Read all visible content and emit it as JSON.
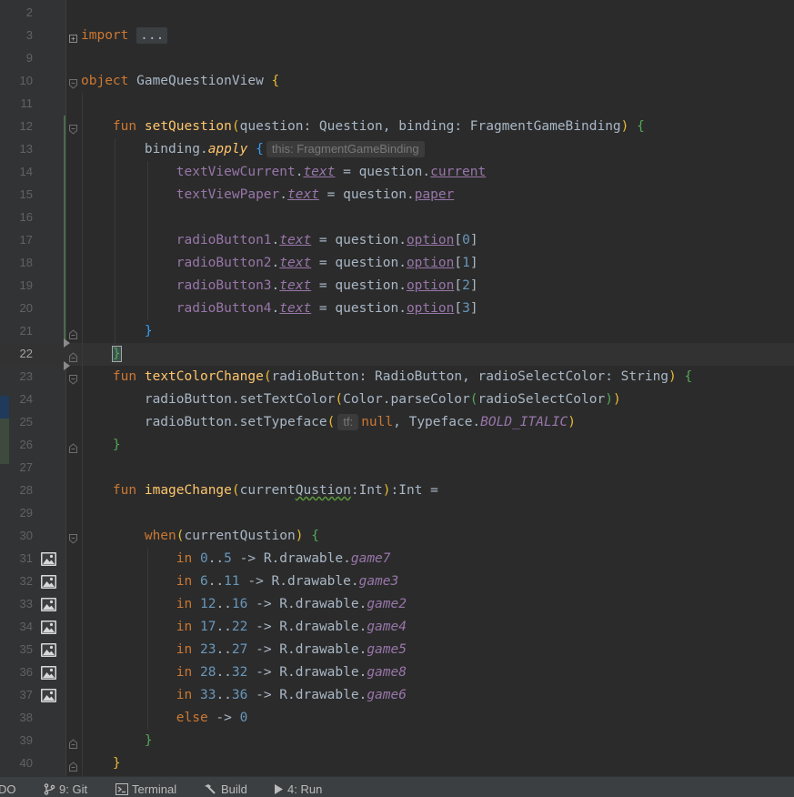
{
  "editor": {
    "current_line": "22",
    "lines": [
      {
        "n": "2",
        "fold": "",
        "icon": false,
        "html": ""
      },
      {
        "n": "3",
        "fold": "plus",
        "icon": false,
        "html": "<span class='kw'>import</span> <span class='collapsed'>...</span>"
      },
      {
        "n": "9",
        "fold": "",
        "icon": false,
        "html": ""
      },
      {
        "n": "10",
        "fold": "open",
        "icon": false,
        "html": "<span class='kw'>object</span> GameQuestionView <span class='paren-y'>{</span>"
      },
      {
        "n": "11",
        "fold": "",
        "icon": false,
        "html": ""
      },
      {
        "n": "12",
        "fold": "open",
        "icon": false,
        "html": "    <span class='kw'>fun</span> <span class='fn'>setQuestion</span><span class='paren-y'>(</span>question: Question, binding: FragmentGameBinding<span class='paren-y'>)</span> <span class='paren-g'>{</span>"
      },
      {
        "n": "13",
        "fold": "",
        "icon": false,
        "html": "        binding.<span class='ext-fn'>apply</span> <span class='paren-b'>{</span><span class='hint'>this: FragmentGameBinding</span>"
      },
      {
        "n": "14",
        "fold": "",
        "icon": false,
        "html": "            <span class='prop'>textViewCurrent</span>.<span class='uitalprop'>text</span> = question.<span class='uprop'>current</span>"
      },
      {
        "n": "15",
        "fold": "",
        "icon": false,
        "html": "            <span class='prop'>textViewPaper</span>.<span class='uitalprop'>text</span> = question.<span class='uprop'>paper</span>"
      },
      {
        "n": "16",
        "fold": "",
        "icon": false,
        "html": ""
      },
      {
        "n": "17",
        "fold": "",
        "icon": false,
        "html": "            <span class='prop'>radioButton1</span>.<span class='uitalprop'>text</span> = question.<span class='uprop'>option</span>[<span class='num'>0</span>]"
      },
      {
        "n": "18",
        "fold": "",
        "icon": false,
        "html": "            <span class='prop'>radioButton2</span>.<span class='uitalprop'>text</span> = question.<span class='uprop'>option</span>[<span class='num'>1</span>]"
      },
      {
        "n": "19",
        "fold": "",
        "icon": false,
        "html": "            <span class='prop'>radioButton3</span>.<span class='uitalprop'>text</span> = question.<span class='uprop'>option</span>[<span class='num'>2</span>]"
      },
      {
        "n": "20",
        "fold": "",
        "icon": false,
        "html": "            <span class='prop'>radioButton4</span>.<span class='uitalprop'>text</span> = question.<span class='uprop'>option</span>[<span class='num'>3</span>]"
      },
      {
        "n": "21",
        "fold": "close",
        "icon": false,
        "html": "        <span class='paren-b'>}</span>"
      },
      {
        "n": "22",
        "fold": "close",
        "icon": false,
        "html": "    <span class='paren-g brace-match'>}</span>"
      },
      {
        "n": "23",
        "fold": "open",
        "icon": false,
        "html": "    <span class='kw'>fun</span> <span class='fn'>textColorChange</span><span class='paren-y'>(</span>radioButton: RadioButton, radioSelectColor: String<span class='paren-y'>)</span> <span class='paren-g'>{</span>"
      },
      {
        "n": "24",
        "fold": "",
        "icon": false,
        "html": "        radioButton.setTextColor<span class='paren-y'>(</span>Color.parseColor<span class='paren-g'>(</span>radioSelectColor<span class='paren-g'>)</span><span class='paren-y'>)</span>"
      },
      {
        "n": "25",
        "fold": "",
        "icon": false,
        "html": "        radioButton.setTypeface<span class='paren-y'>(</span><span class='hint'>tf:</span><span class='kw'>null</span>, Typeface.<span class='ital'>BOLD_ITALIC</span><span class='paren-y'>)</span>"
      },
      {
        "n": "26",
        "fold": "close",
        "icon": false,
        "html": "    <span class='paren-g'>}</span>"
      },
      {
        "n": "27",
        "fold": "",
        "icon": false,
        "html": ""
      },
      {
        "n": "28",
        "fold": "",
        "icon": false,
        "html": "    <span class='kw'>fun</span> <span class='fn'>imageChange</span><span class='paren-y'>(</span>current<span class='typo'>Qustion</span>:Int<span class='paren-y'>)</span>:Int ="
      },
      {
        "n": "29",
        "fold": "",
        "icon": false,
        "html": ""
      },
      {
        "n": "30",
        "fold": "open",
        "icon": false,
        "html": "        <span class='kw'>when</span><span class='paren-y'>(</span>currentQustion<span class='paren-y'>)</span> <span class='paren-g'>{</span>"
      },
      {
        "n": "31",
        "fold": "",
        "icon": true,
        "html": "            <span class='kw'>in</span> <span class='num'>0</span>..<span class='num'>5</span> -&gt; R.drawable.<span class='ital'>game7</span>"
      },
      {
        "n": "32",
        "fold": "",
        "icon": true,
        "html": "            <span class='kw'>in</span> <span class='num'>6</span>..<span class='num'>11</span> -&gt; R.drawable.<span class='ital'>game3</span>"
      },
      {
        "n": "33",
        "fold": "",
        "icon": true,
        "html": "            <span class='kw'>in</span> <span class='num'>12</span>..<span class='num'>16</span> -&gt; R.drawable.<span class='ital'>game2</span>"
      },
      {
        "n": "34",
        "fold": "",
        "icon": true,
        "html": "            <span class='kw'>in</span> <span class='num'>17</span>..<span class='num'>22</span> -&gt; R.drawable.<span class='ital'>game4</span>"
      },
      {
        "n": "35",
        "fold": "",
        "icon": true,
        "html": "            <span class='kw'>in</span> <span class='num'>23</span>..<span class='num'>27</span> -&gt; R.drawable.<span class='ital'>game5</span>"
      },
      {
        "n": "36",
        "fold": "",
        "icon": true,
        "html": "            <span class='kw'>in</span> <span class='num'>28</span>..<span class='num'>32</span> -&gt; R.drawable.<span class='ital'>game8</span>"
      },
      {
        "n": "37",
        "fold": "",
        "icon": true,
        "html": "            <span class='kw'>in</span> <span class='num'>33</span>..<span class='num'>36</span> -&gt; R.drawable.<span class='ital'>game6</span>"
      },
      {
        "n": "38",
        "fold": "",
        "icon": false,
        "html": "            <span class='kw'>else</span> -&gt; <span class='num'>0</span>"
      },
      {
        "n": "39",
        "fold": "close",
        "icon": false,
        "html": "        <span class='paren-g'>}</span>"
      },
      {
        "n": "40",
        "fold": "close",
        "icon": false,
        "html": "    <span class='paren-y'>}</span>"
      }
    ]
  },
  "statusbar": {
    "todo_label": "DO",
    "git_label": "9: Git",
    "terminal_label": "Terminal",
    "build_label": "Build",
    "run_label": "4: Run"
  },
  "colors": {
    "editor_bg": "#2b2b2b",
    "gutter_bg": "#313335",
    "keyword": "#cc7832",
    "function": "#ffc66d",
    "property": "#9876aa",
    "number": "#6897bb",
    "text": "#a9b7c6"
  }
}
